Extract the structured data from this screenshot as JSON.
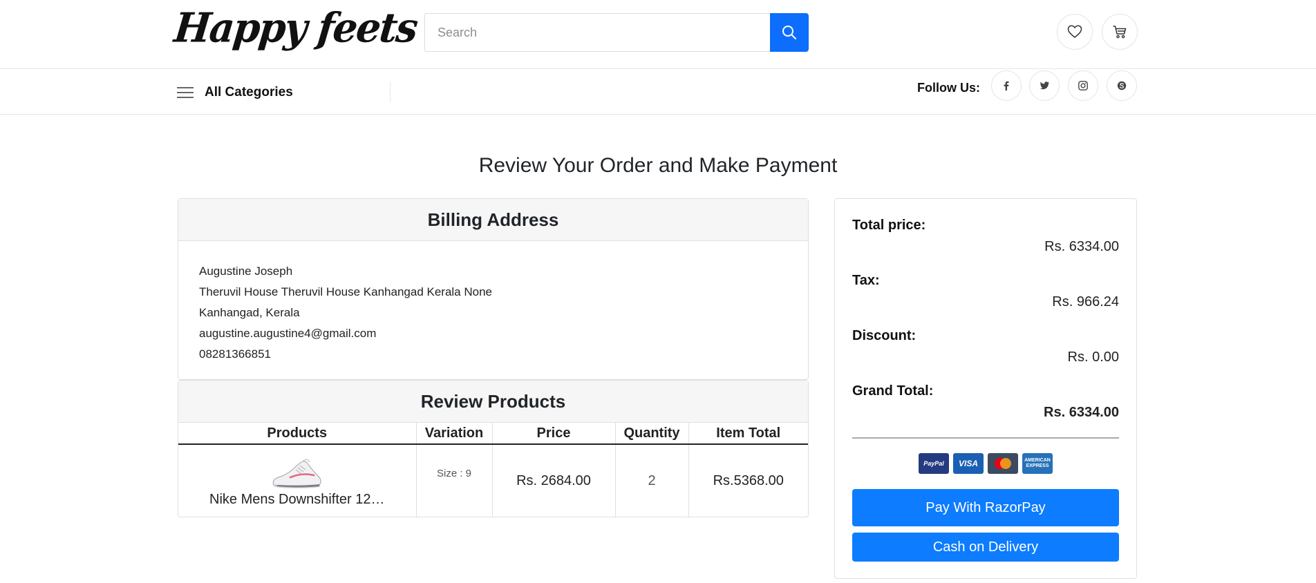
{
  "header": {
    "logo_text": "Happy feets",
    "search": {
      "placeholder": "Search",
      "value": ""
    },
    "icons": [
      "search-icon",
      "heart-icon",
      "cart-icon"
    ]
  },
  "nav": {
    "categories_label": "All Categories",
    "follow_label": "Follow Us:",
    "social": [
      "facebook-icon",
      "twitter-icon",
      "instagram-icon",
      "skype-icon"
    ]
  },
  "page": {
    "title": "Review Your Order and Make Payment"
  },
  "billing": {
    "title": "Billing Address",
    "lines": [
      "Augustine Joseph",
      "Theruvil House Theruvil House Kanhangad Kerala None",
      "Kanhangad, Kerala",
      "augustine.augustine4@gmail.com",
      "08281366851"
    ]
  },
  "products": {
    "title": "Review Products",
    "columns": [
      "Products",
      "Variation",
      "Price",
      "Quantity",
      "Item Total"
    ],
    "rows": [
      {
        "name": "Nike Mens Downshifter 12…",
        "variation": "Size : 9",
        "price": "Rs. 2684.00",
        "quantity": "2",
        "item_total": "Rs.5368.00"
      }
    ]
  },
  "summary": {
    "total_label": "Total price:",
    "total_value": "Rs. 6334.00",
    "tax_label": "Tax:",
    "tax_value": "Rs. 966.24",
    "discount_label": "Discount:",
    "discount_value": "Rs. 0.00",
    "grand_label": "Grand Total:",
    "grand_value": "Rs. 6334.00",
    "payment_cards": [
      "PayPal",
      "VISA",
      "mastercard",
      "AMERICAN EXPRESS"
    ],
    "razorpay_button": "Pay With RazorPay",
    "cod_button": "Cash on Delivery"
  },
  "colors": {
    "primary": "#0d6efd",
    "button": "#0d7cff",
    "border": "#dfdfdf",
    "card_header": "#f6f6f6"
  }
}
